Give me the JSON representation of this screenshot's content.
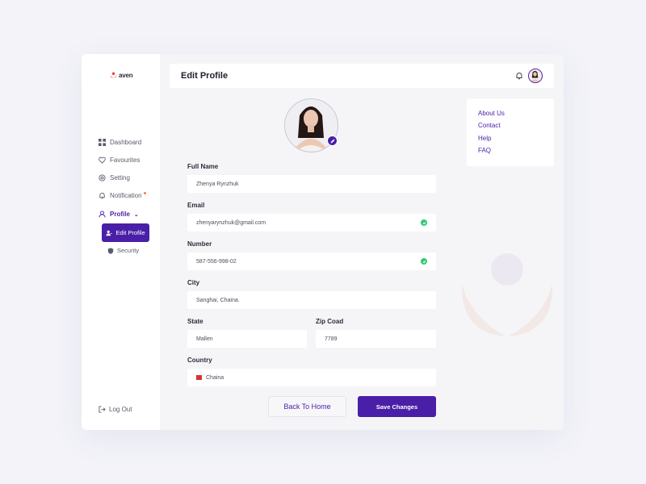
{
  "brand": {
    "name": "aven"
  },
  "sidebar": {
    "items": [
      {
        "label": "Dashboard",
        "icon": "grid-icon"
      },
      {
        "label": "Favourites",
        "icon": "heart-icon"
      },
      {
        "label": "Setting",
        "icon": "gear-icon"
      },
      {
        "label": "Notification",
        "icon": "bell-icon"
      },
      {
        "label": "Profile",
        "icon": "user-icon"
      }
    ],
    "profile_caret": "⌄",
    "sub_items": [
      {
        "label": "Edit Profile",
        "icon": "user-edit-icon"
      },
      {
        "label": "Security",
        "icon": "shield-icon"
      }
    ],
    "logout": "Log Out"
  },
  "header": {
    "title": "Edit Profile"
  },
  "form": {
    "full_name": {
      "label": "Full Name",
      "value": "Zhenya Rynzhuk"
    },
    "email": {
      "label": "Email",
      "value": "zhenyarynzhuk@gmail.com"
    },
    "number": {
      "label": "Number",
      "value": "587-556-998-02"
    },
    "city": {
      "label": "City",
      "value": "Sanghai, Chaina."
    },
    "state": {
      "label": "State",
      "value": "Mallen"
    },
    "zip": {
      "label": "Zip Coad",
      "value": "7789"
    },
    "country": {
      "label": "Country",
      "value": "Chaina"
    }
  },
  "buttons": {
    "back": "Back To Home",
    "save": "Save Changes"
  },
  "links": [
    "About Us",
    "Contact",
    "Help",
    "FAQ"
  ],
  "colors": {
    "accent": "#4a1fa8",
    "success": "#2ecc71",
    "background": "#f5f5f7"
  }
}
